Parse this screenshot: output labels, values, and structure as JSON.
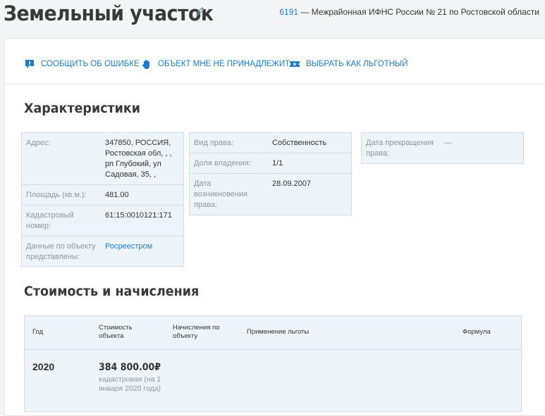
{
  "header": {
    "title": "Земельный участок",
    "tax_office_code": "6191",
    "tax_office_name": " — Межрайонная ИФНС России № 21 по Ростовской области"
  },
  "actions": {
    "report_error": "Сообщить об ошибке",
    "not_mine": "Объект мне не принадлежит",
    "select_benefit": "Выбрать как льготный"
  },
  "characteristics": {
    "title": "Характеристики",
    "address_label": "Адрес:",
    "address_value": "347850, РОССИЯ, Ростовская обл, , , рп Глубокий, ул Садовая, 35, ,",
    "area_label": "Площадь (кв.м.):",
    "area_value": "481.00",
    "cadastral_label": "Кадастровый номер:",
    "cadastral_value": "61:15:0010121:171",
    "source_label": "Данные по объекту представлены:",
    "source_value": "Росреестром",
    "right_type_label": "Вид права:",
    "right_type_value": "Собственность",
    "share_label": "Доля владения:",
    "share_value": "1/1",
    "right_date_label": "Дата возникновения права:",
    "right_date_value": "28.09.2007",
    "end_date_label": "Дата прекращения права:",
    "end_date_value": "—"
  },
  "cost": {
    "title": "Стоимость и начисления",
    "columns": [
      "Год",
      "Стоимость объекта",
      "Начисления по объекту",
      "Применение льготы",
      "Формула"
    ],
    "rows": [
      {
        "year": "2020",
        "cost_value": "384 800.00₽",
        "cost_note": "кадастровая (на 1 января 2020 года)"
      }
    ]
  },
  "colors": {
    "accent": "#1e7dc7",
    "panel_bg": "#eef5fa",
    "panel_border": "#cfdde8"
  }
}
